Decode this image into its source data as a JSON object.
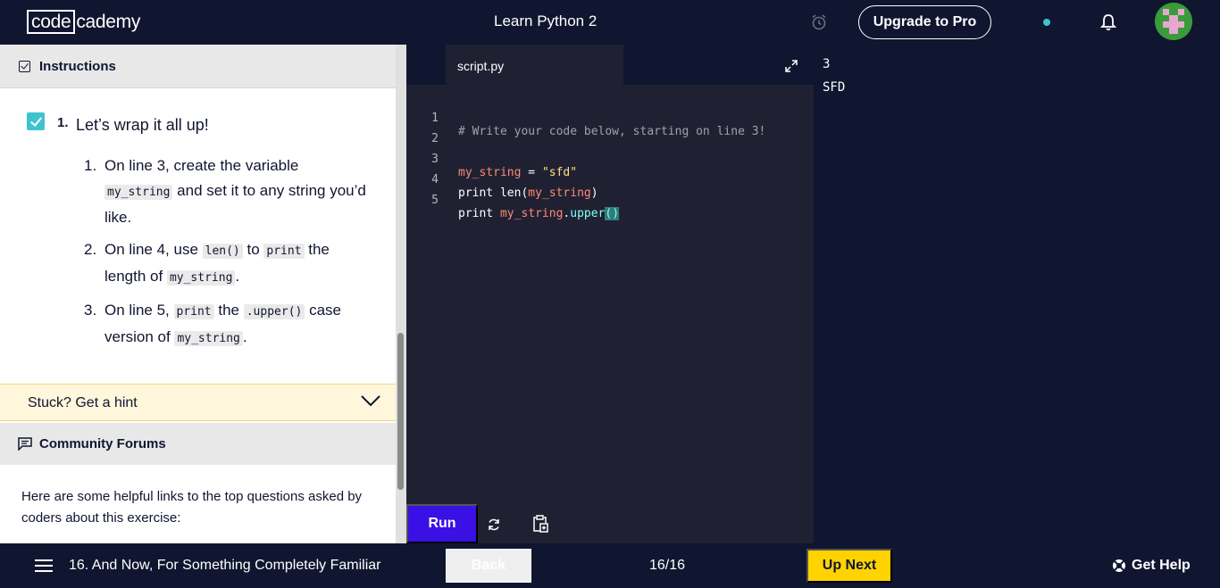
{
  "header": {
    "logo_box": "code",
    "logo_rest": "cademy",
    "course_title": "Learn Python 2",
    "upgrade_label": "Upgrade to Pro",
    "icons": [
      "alarm-icon",
      "status-dot",
      "bell-icon",
      "avatar"
    ]
  },
  "instructions": {
    "header_label": "Instructions",
    "task_number": "1.",
    "task_title": "Let’s wrap it all up!",
    "steps": [
      {
        "num": "1.",
        "pre": "On line 3, create the variable ",
        "code": "my_string",
        "post": " and set it to any string you’d like."
      },
      {
        "num": "2.",
        "pre": "On line 4, use ",
        "code1": "len()",
        "mid": " to ",
        "code2": "print",
        "mid2": " the length of ",
        "code3": "my_string",
        "post": "."
      },
      {
        "num": "3.",
        "pre": "On line 5, ",
        "code1": "print",
        "mid": " the ",
        "code2": ".upper()",
        "mid2": " case version of ",
        "code3": "my_string",
        "post": "."
      }
    ],
    "hint_label": "Stuck? Get a hint",
    "forums_label": "Community Forums",
    "forums_text": "Here are some helpful links to the top questions asked by coders about this exercise:"
  },
  "editor": {
    "tab_label": "script.py",
    "lines": [
      {
        "n": "1"
      },
      {
        "n": "2"
      },
      {
        "n": "3"
      },
      {
        "n": "4"
      },
      {
        "n": "5"
      }
    ],
    "code": {
      "l1": "# Write your code below, starting on line 3!",
      "l3_var": "my_string",
      "l3_eq": " = ",
      "l3_str": "\"sfd\"",
      "l4_kw": "print len(",
      "l4_var": "my_string",
      "l4_end": ")",
      "l5_kw": "print ",
      "l5_var": "my_string",
      "l5_dot": ".",
      "l5_fn": "upper",
      "l5_brk": "()"
    },
    "run_label": "Run"
  },
  "output": {
    "lines": [
      "3",
      "SFD"
    ]
  },
  "footer": {
    "lesson_label": "16. And Now, For Something Completely Familiar",
    "back_label": "Back",
    "progress": "16/16",
    "up_next_label": "Up Next",
    "help_label": "Get Help"
  },
  "colors": {
    "background": "#10162f",
    "editor_bg": "#1f2133",
    "run_button": "#3a10e5",
    "up_next": "#ffd300",
    "accent": "#3fc3cf",
    "hint_bg": "#fff6dc"
  }
}
